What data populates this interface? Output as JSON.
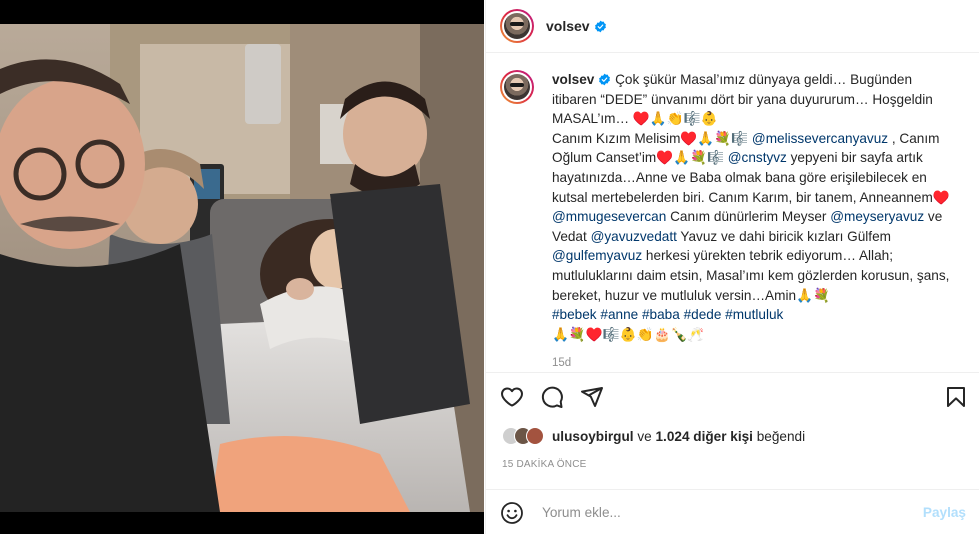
{
  "post": {
    "username": "volsev",
    "caption": {
      "username": "volsev",
      "t1": " Çok şükür Masal’ımız dünyaya geldi… Bugünden itibaren “DEDE” ünvanımı dört bir yana duyururum… Hoşgeldin MASAL’ım… ♥️🙏👏🎼👶",
      "t2": "Canım Kızım Melisim♥️🙏💐🎼 ",
      "m1": "@melissevercanyavuz",
      "t3": " , Canım Oğlum Canset’im♥️🙏💐🎼 ",
      "m2": "@cnstyvz",
      "t4": " yepyeni bir sayfa artık hayatınızda…Anne ve Baba olmak bana göre erişilebilecek en kutsal mertebelerden biri. Canım Karım, bir tanem, Anneannem♥️ ",
      "m3": "@mmugesevercan",
      "t5": " Canım dünürlerim Meyser ",
      "m4": "@meyseryavuz",
      "t6": " ve Vedat ",
      "m5": "@yavuzvedatt",
      "t7": " Yavuz ve dahi biricik kızları Gülfem ",
      "m6": "@gulfemyavuz",
      "t8": " herkesi yürekten tebrik ediyorum… Allah; mutluluklarını daim etsin, Masal’ımı kem gözlerden korusun, şans, bereket, huzur ve mutluluk versin…Amin🙏💐",
      "hashtags": [
        "#bebek",
        "#anne",
        "#baba",
        "#dede",
        "#mutluluk"
      ],
      "emoji_line": "🙏💐♥️🎼👶👏🎂🍾🥂"
    },
    "caption_time": "15d",
    "likes": {
      "first_liker": "ulusoybirgul",
      "middle": " ve ",
      "count_text": "1.024 diğer kişi",
      "suffix": " beğendi"
    },
    "posted_ago": "15 DAKİKA ÖNCE",
    "comment": {
      "placeholder": "Yorum ekle...",
      "post_label": "Paylaş"
    }
  },
  "colors": {
    "link": "#00376b",
    "verified": "#0095f6",
    "post_button_disabled": "#b2dffc",
    "muted": "#8e8e8e"
  },
  "icons": [
    "verified-badge-icon",
    "heart-icon",
    "comment-icon",
    "share-icon",
    "bookmark-icon",
    "emoji-icon"
  ]
}
